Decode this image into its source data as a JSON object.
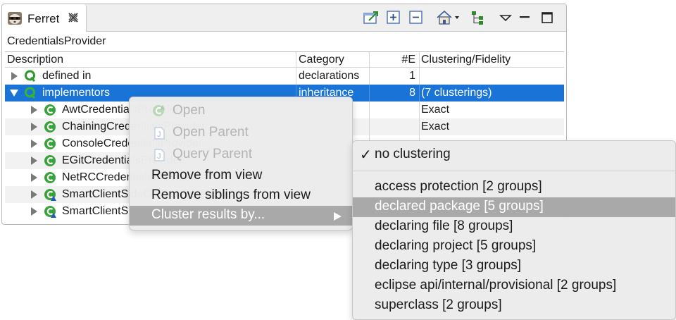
{
  "tab": {
    "title": "Ferret",
    "close_icon": "close-icon"
  },
  "toolbar": {
    "icons": [
      "open-in-editor-icon",
      "expand-all-icon",
      "collapse-all-icon",
      "home-icon",
      "hierarchy-icon",
      "view-menu-icon",
      "minimize-icon",
      "maximize-icon"
    ]
  },
  "view": {
    "title": "CredentialsProvider"
  },
  "columns": {
    "description": "Description",
    "category": "Category",
    "count": "#E",
    "clustering": "Clustering/Fidelity"
  },
  "rows": [
    {
      "description": "defined in",
      "category": "declarations",
      "count": "1",
      "clustering": ""
    },
    {
      "description": "implementors",
      "category": "inheritance",
      "count": "8",
      "clustering": "(7 clusterings)"
    },
    {
      "description": "AwtCredentialsProvider",
      "category": "",
      "count": "",
      "clustering": "Exact"
    },
    {
      "description": "ChainingCredentialsProvider",
      "category": "",
      "count": "",
      "clustering": "Exact"
    },
    {
      "description": "ConsoleCredentialsProvider",
      "category": "",
      "count": "",
      "clustering": ""
    },
    {
      "description": "EGitCredentialsProvider",
      "category": "",
      "count": "",
      "clustering": ""
    },
    {
      "description": "NetRCCredentialsProvider",
      "category": "",
      "count": "",
      "clustering": ""
    },
    {
      "description": "SmartClientSideCredentialsProvider",
      "category": "",
      "count": "",
      "clustering": ""
    },
    {
      "description": "SmartClientSideCredentialsProvider",
      "category": "",
      "count": "",
      "clustering": ""
    }
  ],
  "context_menu": {
    "items": [
      {
        "label": "Open",
        "enabled": false
      },
      {
        "label": "Open Parent",
        "enabled": false
      },
      {
        "label": "Query Parent",
        "enabled": false
      },
      {
        "label": "Remove from view",
        "enabled": true
      },
      {
        "label": "Remove siblings from view",
        "enabled": true
      },
      {
        "label": "Cluster results by...",
        "enabled": true,
        "highlighted": true
      }
    ]
  },
  "submenu": {
    "checked": "no clustering",
    "items": [
      "access protection [2 groups]",
      "declared package [5 groups]",
      "declaring file [8 groups]",
      "declaring project [5 groups]",
      "declaring type [3 groups]",
      "eclipse api/internal/provisional [2 groups]",
      "superclass [2 groups]"
    ],
    "highlighted_index": 1
  },
  "colors": {
    "selection": "#1a74d8",
    "menu_highlight": "#a9a9a9",
    "query_icon": "#2d9a2d"
  }
}
